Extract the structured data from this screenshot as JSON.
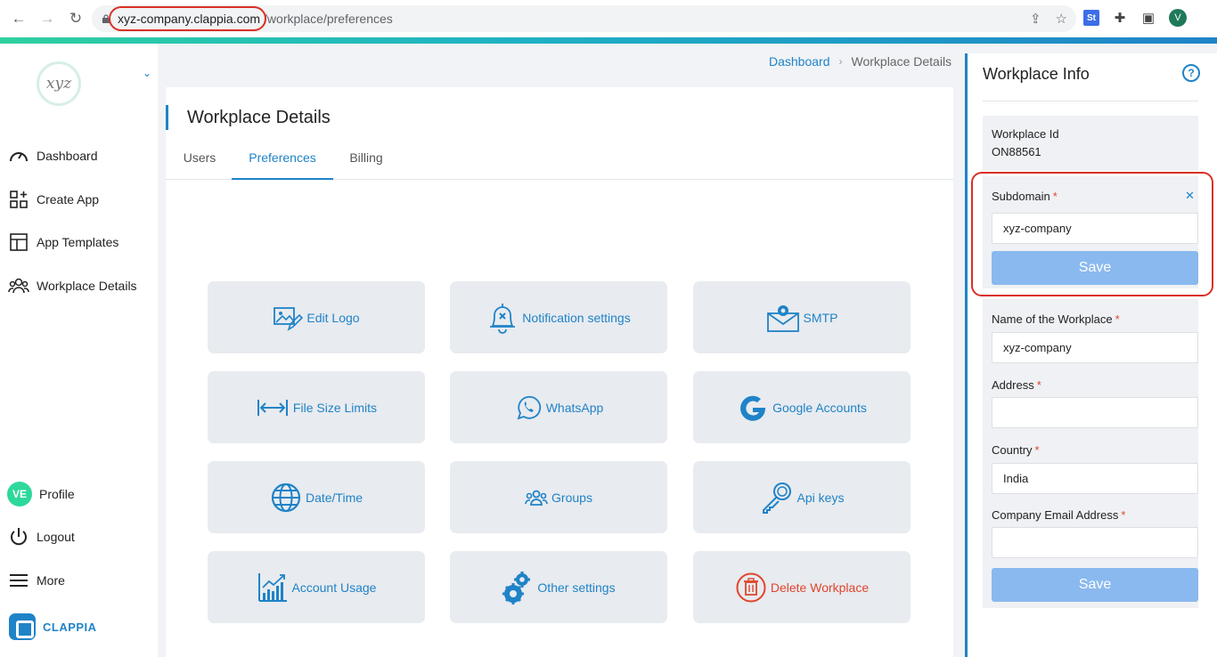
{
  "browser": {
    "url_host": "xyz-company.clappia.com",
    "url_path": "/workplace/preferences",
    "extension_st": "St",
    "profile_initial": "V"
  },
  "sidebar": {
    "logo_text": "xyz",
    "items": [
      {
        "label": "Dashboard",
        "icon": "gauge-icon"
      },
      {
        "label": "Create App",
        "icon": "grid-plus-icon"
      },
      {
        "label": "App Templates",
        "icon": "template-icon"
      },
      {
        "label": "Workplace Details",
        "icon": "users-icon"
      }
    ],
    "profile": {
      "initials": "VE",
      "label": "Profile"
    },
    "logout_label": "Logout",
    "more_label": "More",
    "brand_name": "CLAPPIA"
  },
  "breadcrumb": {
    "link": "Dashboard",
    "current": "Workplace Details"
  },
  "main": {
    "title": "Workplace Details",
    "tabs": [
      {
        "label": "Users",
        "active": false
      },
      {
        "label": "Preferences",
        "active": true
      },
      {
        "label": "Billing",
        "active": false
      }
    ],
    "tiles": [
      {
        "label": "Edit Logo",
        "icon": "image-edit-icon"
      },
      {
        "label": "Notification settings",
        "icon": "bell-icon"
      },
      {
        "label": "SMTP",
        "icon": "mail-gear-icon"
      },
      {
        "label": "File Size Limits",
        "icon": "arrows-horizontal-icon"
      },
      {
        "label": "WhatsApp",
        "icon": "whatsapp-icon"
      },
      {
        "label": "Google Accounts",
        "icon": "google-icon"
      },
      {
        "label": "Date/Time",
        "icon": "globe-icon"
      },
      {
        "label": "Groups",
        "icon": "groups-icon"
      },
      {
        "label": "Api keys",
        "icon": "key-icon"
      },
      {
        "label": "Account Usage",
        "icon": "chart-icon"
      },
      {
        "label": "Other settings",
        "icon": "gears-icon"
      },
      {
        "label": "Delete Workplace",
        "icon": "trash-icon"
      }
    ]
  },
  "workplace_info": {
    "title": "Workplace Info",
    "help": "?",
    "id_label": "Workplace Id",
    "id_value": "ON88561",
    "subdomain_label": "Subdomain",
    "subdomain_value": "xyz-company",
    "save_label": "Save",
    "name_label": "Name of the Workplace",
    "name_value": "xyz-company",
    "address_label": "Address",
    "address_value": "",
    "country_label": "Country",
    "country_value": "India",
    "email_label": "Company Email Address",
    "email_value": "",
    "required_mark": "*"
  },
  "colors": {
    "accent": "#1f83c8",
    "danger": "#e0452c",
    "button_disabled": "#8ab9ef",
    "highlight": "#d93025"
  }
}
